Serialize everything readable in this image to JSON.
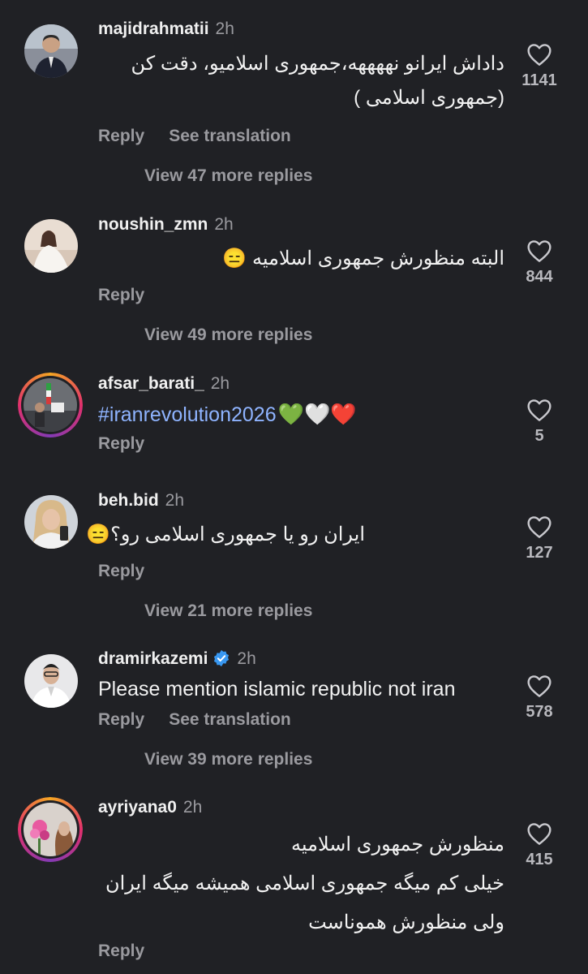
{
  "comments": [
    {
      "username": "majidrahmatii",
      "time": "2h",
      "lines": [
        "داداش ایرانو نههههه،جمهوری اسلامیو، دقت کن",
        "(جمهوری اسلامی )"
      ],
      "like_count": "1141",
      "reply_label": "Reply",
      "translate_label": "See translation",
      "more_replies": "View 47 more replies"
    },
    {
      "username": "noushin_zmn",
      "time": "2h",
      "lines": [
        "البته منظورش جمهوری اسلامیه 😑"
      ],
      "like_count": "844",
      "reply_label": "Reply",
      "more_replies": "View 49 more replies"
    },
    {
      "username": "afsar_barati_",
      "time": "2h",
      "text": "#iranrevolution2026",
      "emojis": "💚🤍❤️",
      "like_count": "5",
      "reply_label": "Reply"
    },
    {
      "username": "beh.bid",
      "time": "2h",
      "lines": [
        "ایران رو یا جمهوری اسلامی رو؟😑"
      ],
      "like_count": "127",
      "reply_label": "Reply",
      "more_replies": "View 21 more replies"
    },
    {
      "username": "dramirkazemi",
      "time": "2h",
      "text": "Please mention islamic republic not iran",
      "like_count": "578",
      "reply_label": "Reply",
      "translate_label": "See translation",
      "more_replies": "View 39 more replies"
    },
    {
      "username": "ayriyana0",
      "time": "2h",
      "lines": [
        "منظورش جمهوری اسلامیه",
        "خیلی کم میگه جمهوری اسلامی همیشه میگه ایران",
        "ولی منظورش هموناست"
      ],
      "like_count": "415",
      "reply_label": "Reply"
    }
  ],
  "colors": {
    "background": "#202125",
    "text": "#f2f2f2",
    "muted": "#9a9a9f",
    "hashtag": "#8fb4ff",
    "verified": "#3897f0"
  },
  "icons": {
    "like": "heart-outline-icon",
    "verified": "verified-badge-icon"
  }
}
